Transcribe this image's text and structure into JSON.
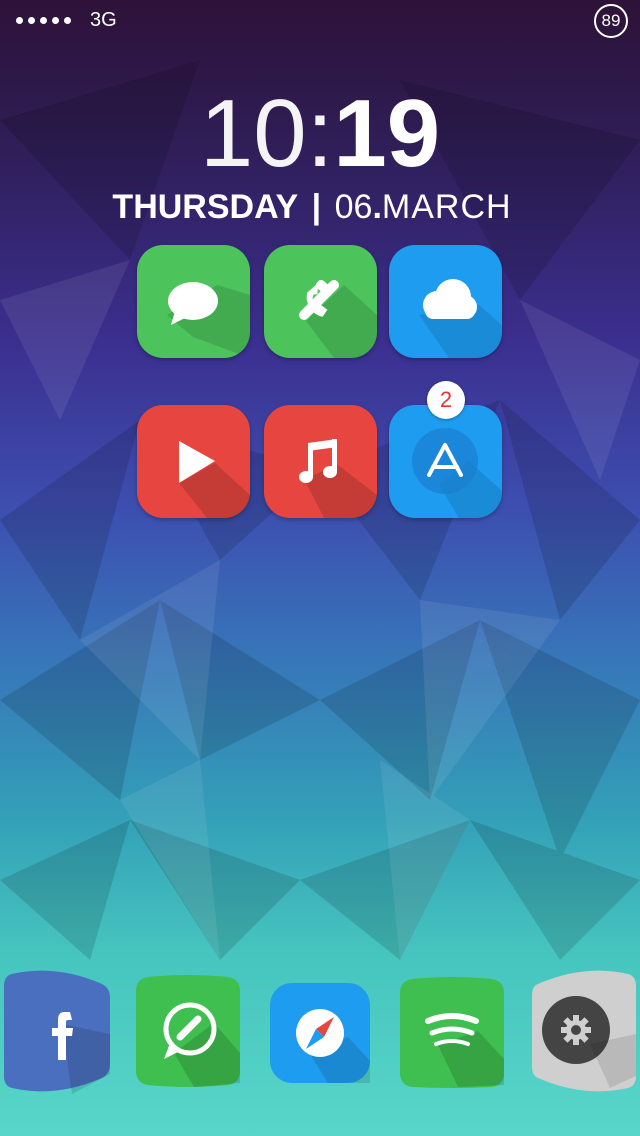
{
  "status_bar": {
    "signal_dots": 5,
    "network": "3G",
    "battery": "89"
  },
  "clock": {
    "hour": "10",
    "separator": ":",
    "minute": "19"
  },
  "date": {
    "weekday": "THURSDAY",
    "separator": "|",
    "day": "06",
    "dot": ".",
    "month": "MARCH"
  },
  "home_apps": [
    {
      "icon": "messages-icon",
      "color": "#4cc35b"
    },
    {
      "icon": "phone-icon",
      "color": "#4cc35b"
    },
    {
      "icon": "weather-icon",
      "color": "#1e9cf0"
    },
    {
      "icon": "youtube-icon",
      "color": "#e6463f"
    },
    {
      "icon": "music-icon",
      "color": "#e6463f"
    },
    {
      "icon": "app-store-icon",
      "color": "#1e9cf0",
      "badge": "2"
    }
  ],
  "dock": [
    {
      "icon": "facebook-icon",
      "color": "#4a6fbf"
    },
    {
      "icon": "whatsapp-icon",
      "color": "#3fbf4f"
    },
    {
      "icon": "safari-icon",
      "color": "#1e9cf0"
    },
    {
      "icon": "spotify-icon",
      "color": "#3fbf4f"
    },
    {
      "icon": "settings-icon",
      "color": "#cfcfcf"
    }
  ]
}
